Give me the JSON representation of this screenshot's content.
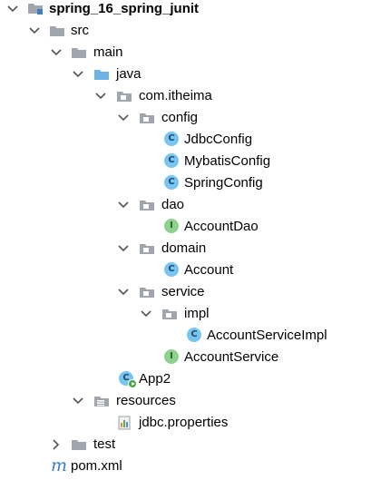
{
  "tree": {
    "project": "spring_16_spring_junit",
    "src": "src",
    "main": "main",
    "java": "java",
    "package": "com.itheima",
    "config": "config",
    "jdbc_config": "JdbcConfig",
    "mybatis_config": "MybatisConfig",
    "spring_config": "SpringConfig",
    "dao": "dao",
    "account_dao": "AccountDao",
    "domain": "domain",
    "account": "Account",
    "service": "service",
    "impl": "impl",
    "account_service_impl": "AccountServiceImpl",
    "account_service": "AccountService",
    "app2": "App2",
    "resources": "resources",
    "jdbc_properties": "jdbc.properties",
    "test": "test",
    "pom": "pom.xml"
  },
  "icons": {
    "class_letter": "C",
    "interface_letter": "I",
    "maven_letter": "m",
    "class_color": "#79c5f0",
    "interface_color": "#8dd08d",
    "folder_color": "#a0a6ad",
    "source_folder_color": "#6db3e4"
  }
}
